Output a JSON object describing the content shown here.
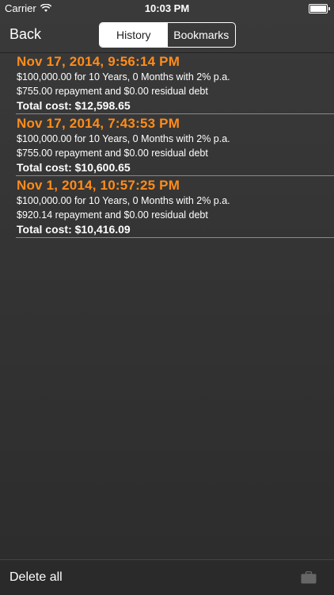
{
  "status_bar": {
    "carrier": "Carrier",
    "time": "10:03 PM",
    "icons": [
      "wifi-icon",
      "battery-icon"
    ]
  },
  "nav": {
    "back_label": "Back",
    "segments": [
      {
        "label": "History",
        "selected": true
      },
      {
        "label": "Bookmarks",
        "selected": false
      }
    ]
  },
  "history": [
    {
      "title": "Nov 17, 2014, 9:56:14 PM",
      "line1": "$100,000.00 for 10 Years, 0 Months with 2% p.a.",
      "line2": "$755.00 repayment and $0.00 residual debt",
      "total": "Total cost: $12,598.65"
    },
    {
      "title": "Nov 17, 2014, 7:43:53 PM",
      "line1": "$100,000.00 for 10 Years, 0 Months with 2% p.a.",
      "line2": "$755.00 repayment and $0.00 residual debt",
      "total": "Total cost: $10,600.65"
    },
    {
      "title": "Nov 1, 2014, 10:57:25 PM",
      "line1": "$100,000.00 for 10 Years, 0 Months with 2% p.a.",
      "line2": "$920.14 repayment and $0.00 residual debt",
      "total": "Total cost: $10,416.09"
    }
  ],
  "toolbar": {
    "delete_all_label": "Delete all",
    "right_icon": "briefcase-icon"
  },
  "colors": {
    "accent": "#ff8c1a",
    "background": "#333333"
  }
}
